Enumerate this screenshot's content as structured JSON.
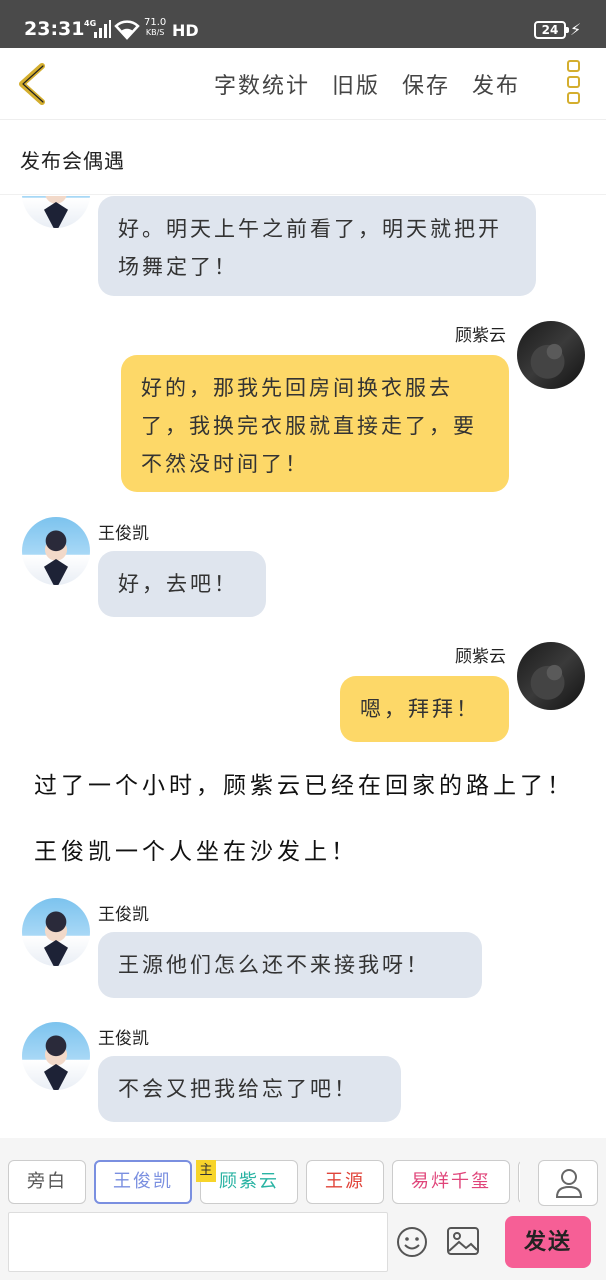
{
  "status_bar": {
    "time": "23:31",
    "network": "4G",
    "speed_value": "71.0",
    "speed_unit": "KB/S",
    "hd": "HD",
    "battery": "24"
  },
  "nav": {
    "back_icon": "chevron-left-icon",
    "actions": [
      "字数统计",
      "旧版",
      "保存",
      "发布"
    ],
    "more_icon": "more-vertical-icon",
    "accent_color": "#d4ae2e"
  },
  "title": "发布会偶遇",
  "messages": [
    {
      "side": "left",
      "avatar": "wang-avatar",
      "name": "",
      "text": "好。明天上午之前看了，明天就把开场舞定了！"
    },
    {
      "side": "right",
      "avatar": "gu-avatar",
      "name": "顾紫云",
      "text": "好的，那我先回房间换衣服去了，我换完衣服就直接走了，要不然没时间了！"
    },
    {
      "side": "left",
      "avatar": "wang-avatar",
      "name": "王俊凯",
      "text": "好，去吧！"
    },
    {
      "side": "right",
      "avatar": "gu-avatar",
      "name": "顾紫云",
      "text": "嗯，拜拜！"
    },
    {
      "type": "narration",
      "text": "过了一个小时，顾紫云已经在回家的路上了！"
    },
    {
      "type": "narration",
      "text": "王俊凯一个人坐在沙发上！"
    },
    {
      "side": "left",
      "avatar": "wang-avatar",
      "name": "王俊凯",
      "text": "王源他们怎么还不来接我呀！"
    },
    {
      "side": "left",
      "avatar": "wang-avatar",
      "name": "王俊凯",
      "text": "不会又把我给忘了吧！"
    }
  ],
  "roles": [
    {
      "label": "旁白",
      "color": "#555555"
    },
    {
      "label": "王俊凯",
      "color": "#7a8fe0",
      "selected": true
    },
    {
      "label": "顾紫云",
      "color": "#2ab3a3",
      "badge": "主"
    },
    {
      "label": "王源",
      "color": "#e0443a"
    },
    {
      "label": "易烊千玺",
      "color": "#e0457a"
    }
  ],
  "composer": {
    "placeholder": "",
    "emoji_icon": "smiley-icon",
    "image_icon": "image-icon",
    "person_icon": "person-icon",
    "send_label": "发送",
    "send_color": "#f65f96"
  },
  "colors": {
    "left_bubble": "#dfe5ee",
    "right_bubble": "#fdd868"
  }
}
